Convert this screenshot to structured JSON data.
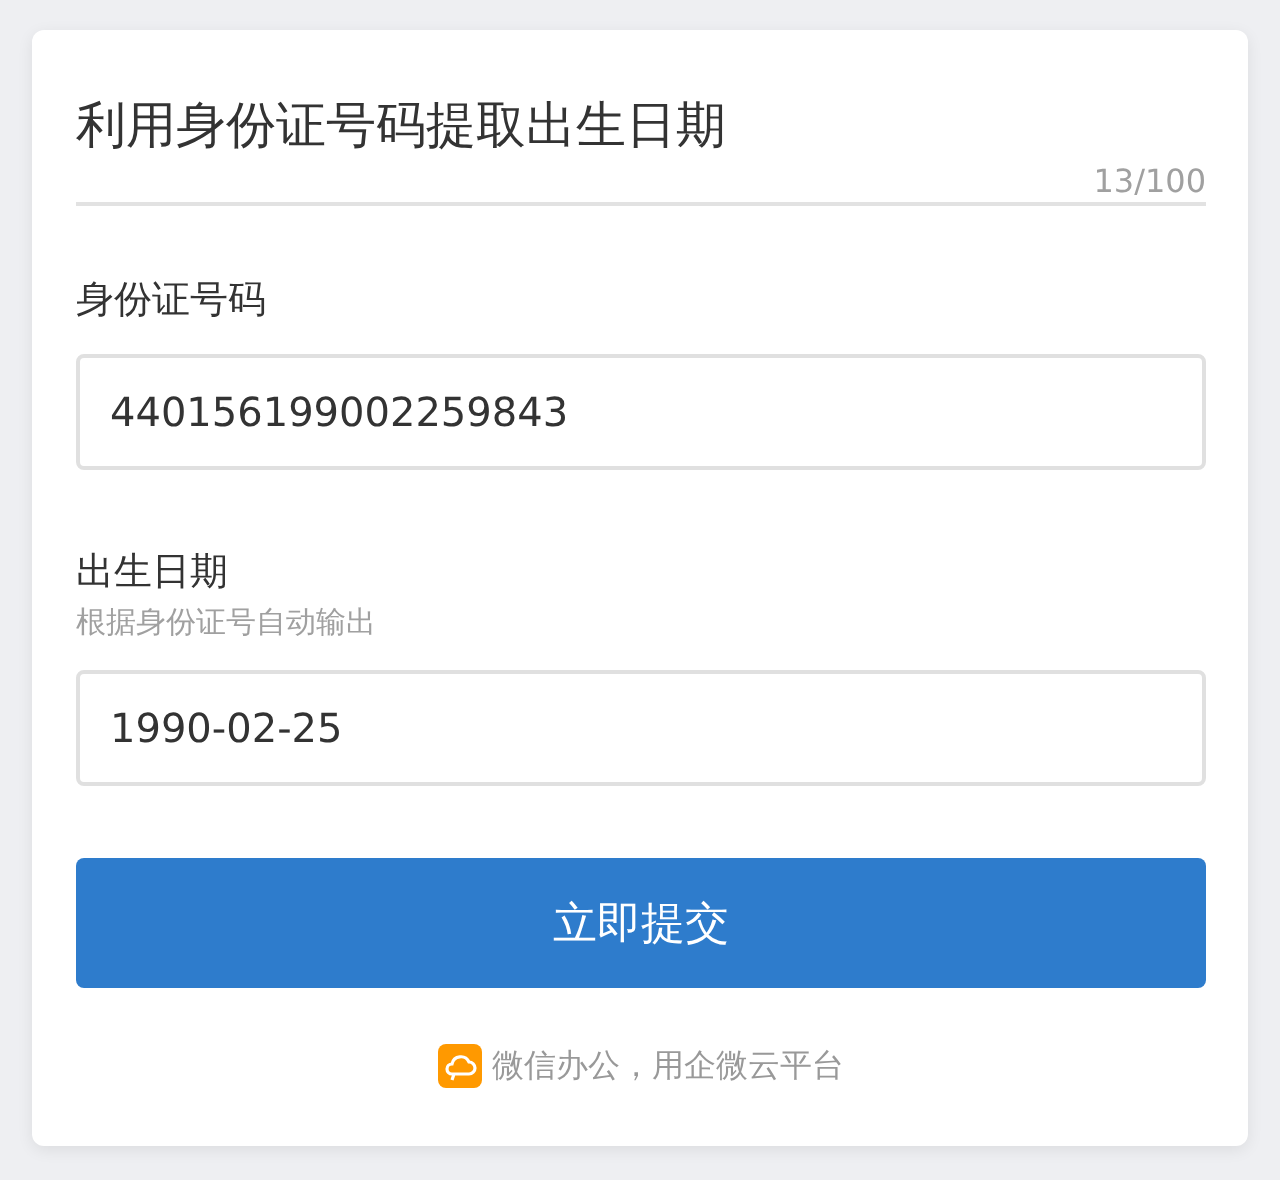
{
  "form": {
    "title": "利用身份证号码提取出生日期",
    "title_counter": "13/100"
  },
  "fields": [
    {
      "label": "身份证号码",
      "value": "440156199002259843"
    },
    {
      "label": "出生日期",
      "hint": "根据身份证号自动输出",
      "value": "1990-02-25"
    }
  ],
  "submit_button": "立即提交",
  "footer": {
    "text": "微信办公，用企微云平台"
  }
}
